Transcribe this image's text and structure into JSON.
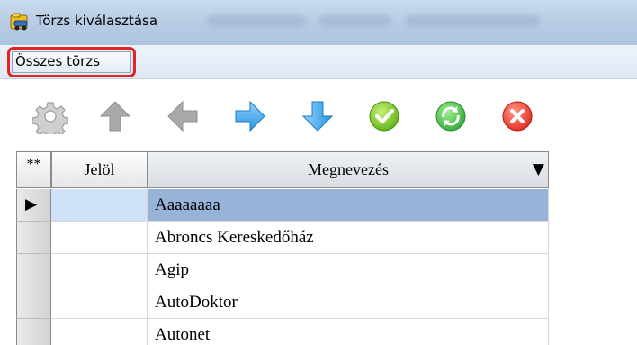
{
  "window": {
    "title": "Törzs kiválasztása",
    "icon": "folder-car-icon"
  },
  "menu": {
    "items": [
      {
        "label": "Összes törzs"
      }
    ]
  },
  "toolbar": {
    "buttons": [
      {
        "icon": "gear-icon",
        "enabled": false
      },
      {
        "icon": "arrow-up-icon",
        "enabled": false
      },
      {
        "icon": "arrow-left-icon",
        "enabled": false
      },
      {
        "icon": "arrow-right-icon",
        "enabled": true
      },
      {
        "icon": "arrow-down-icon",
        "enabled": true
      },
      {
        "icon": "ok-check-icon",
        "enabled": true
      },
      {
        "icon": "refresh-icon",
        "enabled": true
      },
      {
        "icon": "cancel-x-icon",
        "enabled": true
      }
    ]
  },
  "grid": {
    "columns": {
      "indicator": "**",
      "jelol": "Jelöl",
      "name": "Megnevezés",
      "sort_symbol": "▼"
    },
    "current_row_marker": "▶",
    "rows": [
      {
        "name": "Aaaaaaaa",
        "selected": true
      },
      {
        "name": "Abroncs Kereskedőház",
        "selected": false
      },
      {
        "name": "Agip",
        "selected": false
      },
      {
        "name": "AutoDoktor",
        "selected": false
      },
      {
        "name": "Autonet",
        "selected": false
      }
    ]
  },
  "colors": {
    "highlight_box": "#e02424",
    "selected_row": "#97b4d8",
    "selected_jelol": "#cfe2f7"
  }
}
